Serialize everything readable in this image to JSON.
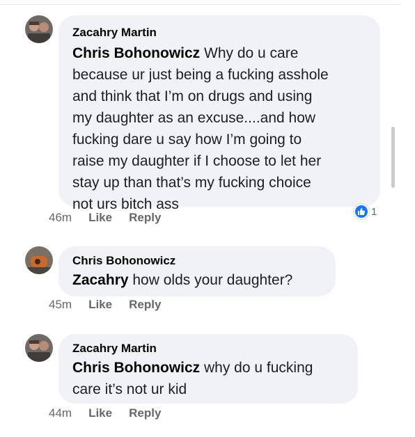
{
  "comments": [
    {
      "author": "Zacahry Martin",
      "mention": "Chris Bohonowicz",
      "text": " Why do u care\nbecause ur just being a fucking asshole\nand think that I’m on drugs and using\nmy daughter as an excuse....and how\nfucking dare u say how I’m going to\nraise my daughter if I choose to let her\nstay up than that’s my fucking choice\nnot urs bitch ass",
      "time": "46m",
      "like_label": "Like",
      "reply_label": "Reply",
      "reaction_count": "1"
    },
    {
      "author": "Chris Bohonowicz",
      "mention": "Zacahry",
      "text": " how olds your daughter?",
      "time": "45m",
      "like_label": "Like",
      "reply_label": "Reply"
    },
    {
      "author": "Zacahry Martin",
      "mention": "Chris Bohonowicz",
      "text": " why do u fucking\ncare it’s not ur kid",
      "time": "44m",
      "like_label": "Like",
      "reply_label": "Reply"
    }
  ],
  "icons": {
    "reaction": "thumbs-up-icon"
  },
  "colors": {
    "bubble": "#f0f2f5",
    "meta": "#65676b",
    "like_blue": "#1877f2"
  }
}
